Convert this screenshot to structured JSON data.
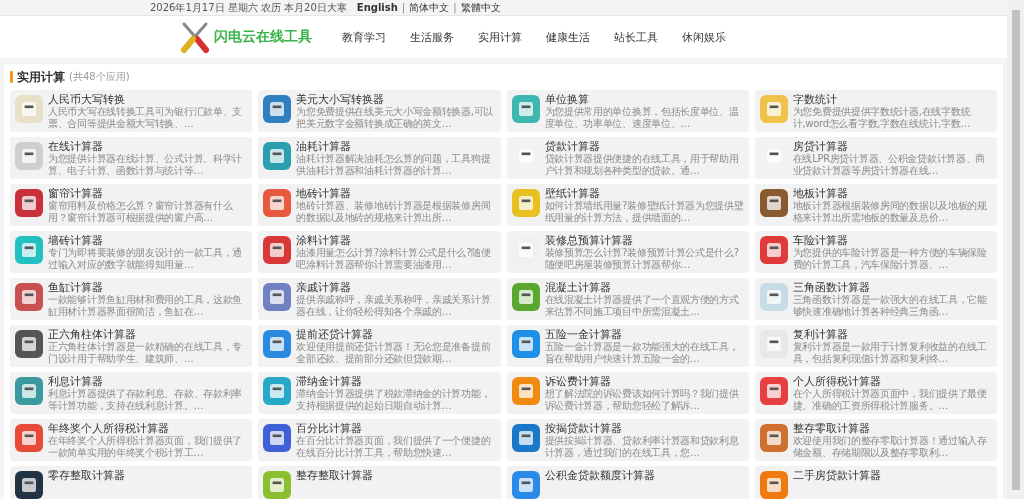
{
  "top_bar": {
    "date": "2026年1月17日 星期六 农历 本月20日大寒",
    "languages": [
      {
        "label": "English",
        "selected": true
      },
      {
        "label": "简体中文",
        "selected": false
      },
      {
        "label": "繁體中文",
        "selected": false
      }
    ],
    "separator": "|"
  },
  "header": {
    "logo_text": "闪电云在线工具",
    "nav": [
      {
        "label": "教育学习"
      },
      {
        "label": "生活服务"
      },
      {
        "label": "实用计算"
      },
      {
        "label": "健康生活"
      },
      {
        "label": "站长工具"
      },
      {
        "label": "休闲娱乐"
      }
    ]
  },
  "section": {
    "title": "实用计算",
    "count": "(共48个应用)"
  },
  "apps": [
    {
      "title": "人民币大写转换",
      "desc": "人民币大写在线转换工具可为银行汇款单、支票、合同等提供金额大写转换、…"
    },
    {
      "title": "美元大小写转换器",
      "desc": "为您免费提供在线美元大小写金额转换器,可以把美元数字金额转换成正确的英文…"
    },
    {
      "title": "单位换算",
      "desc": "为您提供常用的单位换算，包括长度单位、温度单位、功率单位、速度单位、…"
    },
    {
      "title": "字数统计",
      "desc": "为您免费提供提供字数统计器,在线字数统计,word怎么看字数,字数在线统计,字数…"
    },
    {
      "title": "在线计算器",
      "desc": "为您提供计算器在线计算、公式计算、科学计算、电子计算、函数计算与统计等…"
    },
    {
      "title": "油耗计算器",
      "desc": "油耗计算器解决油耗怎么算的问题，工具狗提供油耗计算器和油耗计算器的计算…"
    },
    {
      "title": "贷款计算器",
      "desc": "贷款计算器提供便捷的在线工具，用于帮助用户计算和规划各种类型的贷款。通…"
    },
    {
      "title": "房贷计算器",
      "desc": "在线LPR房贷计算器、公积金贷款计算器、商业贷款计算器等房贷计算器在线…"
    },
    {
      "title": "窗帘计算器",
      "desc": "窗帘用料及价格怎么算？窗帘计算器有什么用？窗帘计算器可根据提供的窗户高…"
    },
    {
      "title": "地砖计算器",
      "desc": "地砖计算器、装修地砖计算器是根据装修房间的数据以及地砖的规格来计算出所…"
    },
    {
      "title": "壁纸计算器",
      "desc": "如何计算墙纸用量?装修壁纸计算器为您提供壁纸用量的计算方法，提供墙面的…"
    },
    {
      "title": "地板计算器",
      "desc": "地板计算器根据装修房间的数据以及地板的规格来计算出所需地板的数量及总价…"
    },
    {
      "title": "墙砖计算器",
      "desc": "专门为即将要装修的朋友设计的一款工具，通过输入对应的数字就能得知用量…"
    },
    {
      "title": "涂料计算器",
      "desc": "油漆用量怎么计算?涂料计算公式是什么?随便吧涂料计算器帮你计算需要油漆用…"
    },
    {
      "title": "装修总预算计算器",
      "desc": "装修预算怎么计算?装修预算计算公式是什么?随便吧房屋装修预算计算器帮你…"
    },
    {
      "title": "车险计算器",
      "desc": "为您提供的车险计算器是一种方便的车辆保险费的计算工具，汽车保险计算器、…"
    },
    {
      "title": "鱼缸计算器",
      "desc": "一款能够计算鱼缸用材和费用的工具，这款鱼缸用材计算器界面很简洁，鱼缸在…"
    },
    {
      "title": "亲戚计算器",
      "desc": "提供亲戚称呼，亲戚关系称呼，亲戚关系计算器在线，让你轻松得知各个亲戚的…"
    },
    {
      "title": "混凝土计算器",
      "desc": "在线混凝土计算器提供了一个直观方便的方式来估算不同施工项目中所需混凝土…"
    },
    {
      "title": "三角函数计算器",
      "desc": "三角函数计算器是一款强大的在线工具，它能够快速准确地计算各种经典三角函…"
    },
    {
      "title": "正六角柱体计算器",
      "desc": "正六角柱体计算器是一款精确的在线工具，专门设计用于帮助学生、建筑师、…"
    },
    {
      "title": "提前还贷计算器",
      "desc": "欢迎使用提前还贷计算器！无论您是准备提前全部还款、提前部分还款但贷款期…"
    },
    {
      "title": "五险一金计算器",
      "desc": "五险一金计算器是一款功能强大的在线工具，旨在帮助用户快速计算五险一金的…"
    },
    {
      "title": "复利计算器",
      "desc": "复利计算器是一款用于计算复利收益的在线工具，包括复利现值计算器和复利终…"
    },
    {
      "title": "利息计算器",
      "desc": "利息计算器提供了存款利息、存款、存款利率等计算功能，支持在线利息计算。…"
    },
    {
      "title": "滞纳金计算器",
      "desc": "滞纳金计算器提供了税款滞纳金的计算功能，支持根据提供的起始日期自动计算…"
    },
    {
      "title": "诉讼费计算器",
      "desc": "想了解法院的诉讼费该如何计算吗？我们提供诉讼费计算器，帮助您轻松了解诉…"
    },
    {
      "title": "个人所得税计算器",
      "desc": "在个人所得税计算器页面中，我们提供了最便捷、准确的工资所得税计算服务。…"
    },
    {
      "title": "年终奖个人所得税计算器",
      "desc": "在年终奖个人所得税计算器页面，我们提供了一款简单实用的年终奖个税计算工…"
    },
    {
      "title": "百分比计算器",
      "desc": "在百分比计算器页面，我们提供了一个便捷的在线百分比计算工具，帮助您快速…"
    },
    {
      "title": "按揭贷款计算器",
      "desc": "提供按揭计算器、贷款利率计算器和贷款利息计算器，通过我们的在线工具，您…"
    },
    {
      "title": "整存零取计算器",
      "desc": "欢迎使用我们的整存零取计算器！通过输入存储金额、存储期限以及整存零取利…"
    },
    {
      "title": "零存整取计算器"
    },
    {
      "title": "整存整取计算器"
    },
    {
      "title": "公积金贷款额度计算器"
    },
    {
      "title": "二手房贷款计算器"
    }
  ]
}
